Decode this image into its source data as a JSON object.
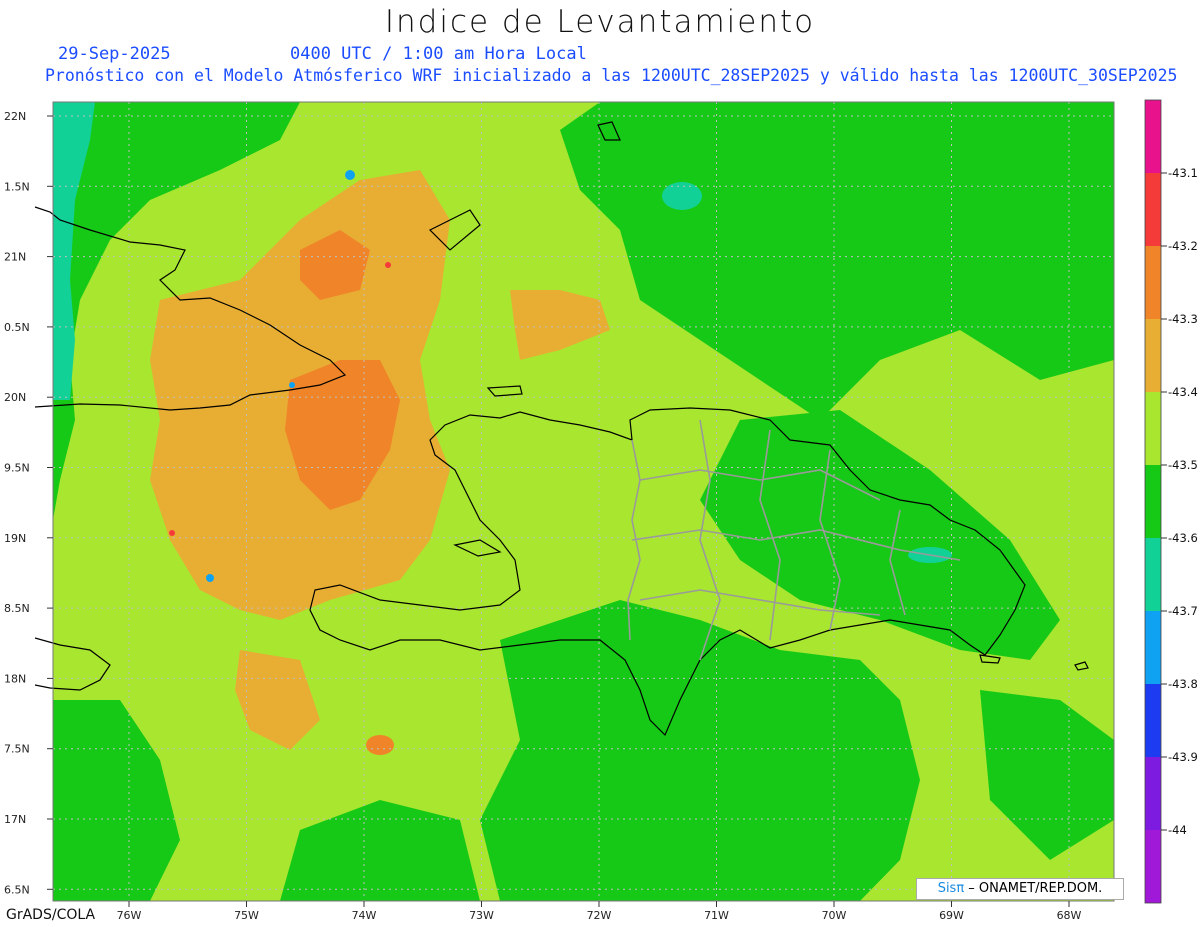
{
  "title": "Indice de Levantamiento",
  "date": "29-Sep-2025",
  "time": "0400 UTC / 1:00 am Hora Local",
  "forecast": "Pronóstico con el Modelo Atmósferico WRF inicializado a las 1200UTC_28SEP2025 y válido hasta las  1200UTC_30SEP2025",
  "lat_labels": [
    "22N",
    "1.5N",
    "21N",
    "0.5N",
    "20N",
    "9.5N",
    "19N",
    "8.5N",
    "18N",
    "7.5N",
    "17N",
    "6.5N"
  ],
  "lon_labels": [
    "76W",
    "75W",
    "74W",
    "73W",
    "72W",
    "71W",
    "70W",
    "69W",
    "68W"
  ],
  "colorbar": {
    "labels": [
      "-43.1",
      "-43.2",
      "-43.3",
      "-43.4",
      "-43.5",
      "-43.6",
      "-43.7",
      "-43.8",
      "-43.9",
      "-44"
    ],
    "colors": [
      "#e8138c",
      "#f53a3a",
      "#f08428",
      "#e8ae34",
      "#a8e630",
      "#17c917",
      "#12d197",
      "#10a2f2",
      "#1d3cf2",
      "#7e1be0",
      "#a018d8"
    ]
  },
  "footer": "GrADS/COLA",
  "credit": {
    "sis": "Sisπ",
    "rest": " – ONAMET/REP.DOM."
  }
}
